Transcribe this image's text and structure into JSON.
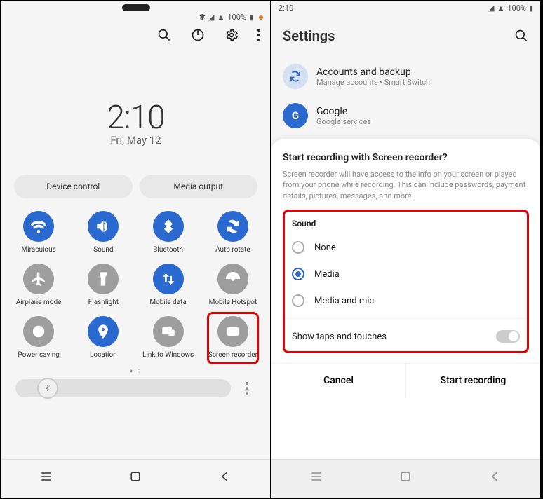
{
  "left": {
    "statusbar": {
      "battery": "100%"
    },
    "clock": {
      "time": "2:10",
      "date": "Fri, May 12"
    },
    "pills": {
      "device_control": "Device control",
      "media_output": "Media output"
    },
    "qs": [
      {
        "label": "Miraculous",
        "icon": "wifi",
        "state": "on"
      },
      {
        "label": "Sound",
        "icon": "sound",
        "state": "on"
      },
      {
        "label": "Bluetooth",
        "icon": "bluetooth",
        "state": "on"
      },
      {
        "label": "Auto rotate",
        "icon": "rotate",
        "state": "on"
      },
      {
        "label": "Airplane mode",
        "icon": "airplane",
        "state": "off"
      },
      {
        "label": "Flashlight",
        "icon": "flashlight",
        "state": "off"
      },
      {
        "label": "Mobile data",
        "icon": "mobiledata",
        "state": "on"
      },
      {
        "label": "Mobile Hotspot",
        "icon": "hotspot",
        "state": "off"
      },
      {
        "label": "Power saving",
        "icon": "power",
        "state": "off"
      },
      {
        "label": "Location",
        "icon": "location",
        "state": "on"
      },
      {
        "label": "Link to Windows",
        "icon": "link",
        "state": "off"
      },
      {
        "label": "Screen recorder",
        "icon": "screenrec",
        "state": "off",
        "highlight": true
      }
    ]
  },
  "right": {
    "statusbar": {
      "time": "2:10",
      "battery": "100%"
    },
    "settings_title": "Settings",
    "rows": {
      "backup": {
        "title": "Accounts and backup",
        "sub": "Manage accounts • Smart Switch"
      },
      "google": {
        "title": "Google",
        "sub": "Google services",
        "letter": "G"
      }
    },
    "sheet": {
      "title": "Start recording with Screen recorder?",
      "desc": "Screen recorder will have access to the info on your screen or played from your phone while recording. This can include passwords, payment details, pictures, messages, and more.",
      "sound_heading": "Sound",
      "options": {
        "none": "None",
        "media": "Media",
        "media_mic": "Media and mic"
      },
      "selected": "media",
      "show_taps": "Show taps and touches",
      "cancel": "Cancel",
      "start": "Start recording"
    }
  }
}
